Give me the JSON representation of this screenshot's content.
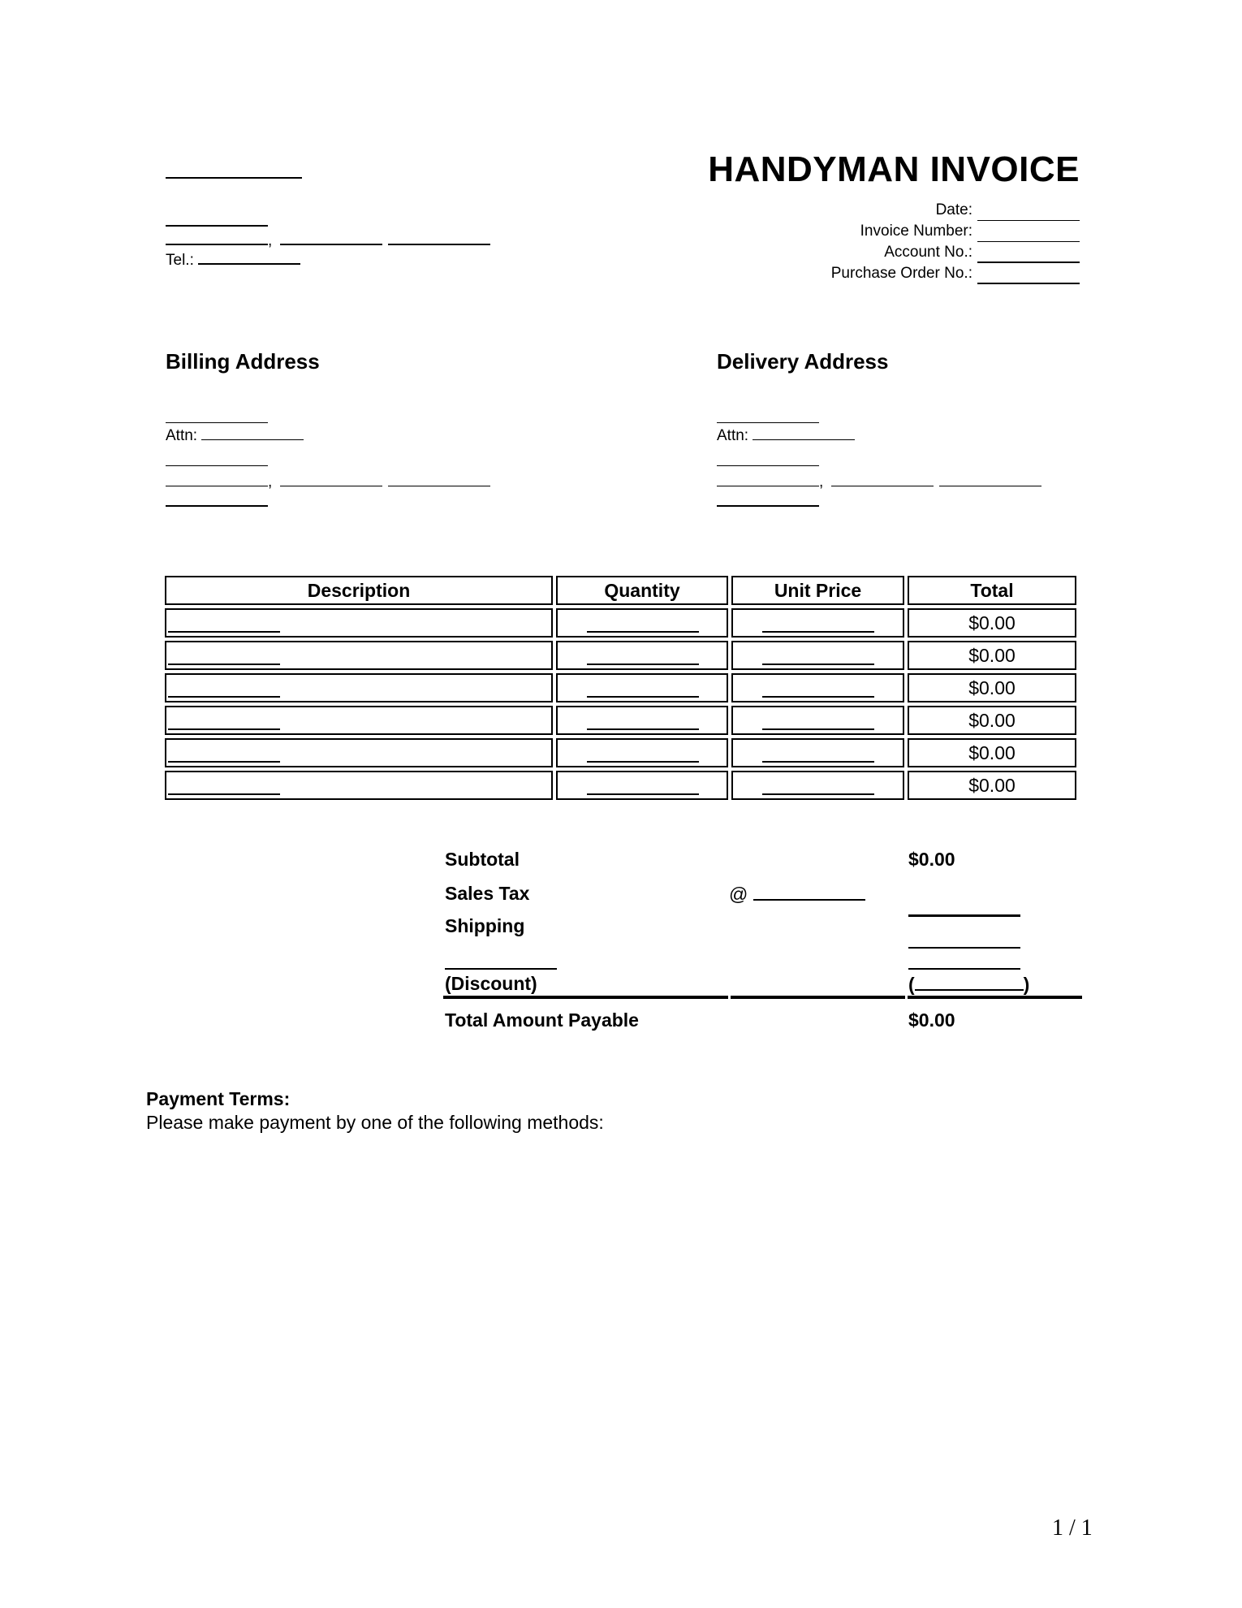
{
  "document": {
    "title": "HANDYMAN INVOICE",
    "company": {
      "tel_label": "Tel.:",
      "comma": ","
    },
    "meta_fields": [
      {
        "label": "Date:",
        "value": ""
      },
      {
        "label": "Invoice Number:",
        "value": ""
      },
      {
        "label": "Account No.:",
        "value": ""
      },
      {
        "label": "Purchase Order No.:",
        "value": ""
      }
    ],
    "billing": {
      "heading": "Billing Address",
      "attn_label": "Attn:",
      "comma": ","
    },
    "delivery": {
      "heading": "Delivery Address",
      "attn_label": "Attn:",
      "comma": ","
    },
    "table": {
      "headers": [
        "Description",
        "Quantity",
        "Unit Price",
        "Total"
      ],
      "rows": [
        {
          "description": "",
          "quantity": "",
          "unit_price": "",
          "total": "$0.00"
        },
        {
          "description": "",
          "quantity": "",
          "unit_price": "",
          "total": "$0.00"
        },
        {
          "description": "",
          "quantity": "",
          "unit_price": "",
          "total": "$0.00"
        },
        {
          "description": "",
          "quantity": "",
          "unit_price": "",
          "total": "$0.00"
        },
        {
          "description": "",
          "quantity": "",
          "unit_price": "",
          "total": "$0.00"
        },
        {
          "description": "",
          "quantity": "",
          "unit_price": "",
          "total": "$0.00"
        }
      ]
    },
    "totals": {
      "subtotal_label": "Subtotal",
      "subtotal_value": "$0.00",
      "sales_tax_label": "Sales Tax",
      "tax_rate_prefix": "@",
      "shipping_label": "Shipping",
      "discount_label": "(Discount)",
      "discount_open": "(",
      "discount_close": ")",
      "total_label": "Total Amount Payable",
      "total_value": "$0.00"
    },
    "payment": {
      "heading": "Payment Terms:",
      "text": "Please make payment by one of the following methods:"
    },
    "page_indicator": "1 / 1"
  }
}
